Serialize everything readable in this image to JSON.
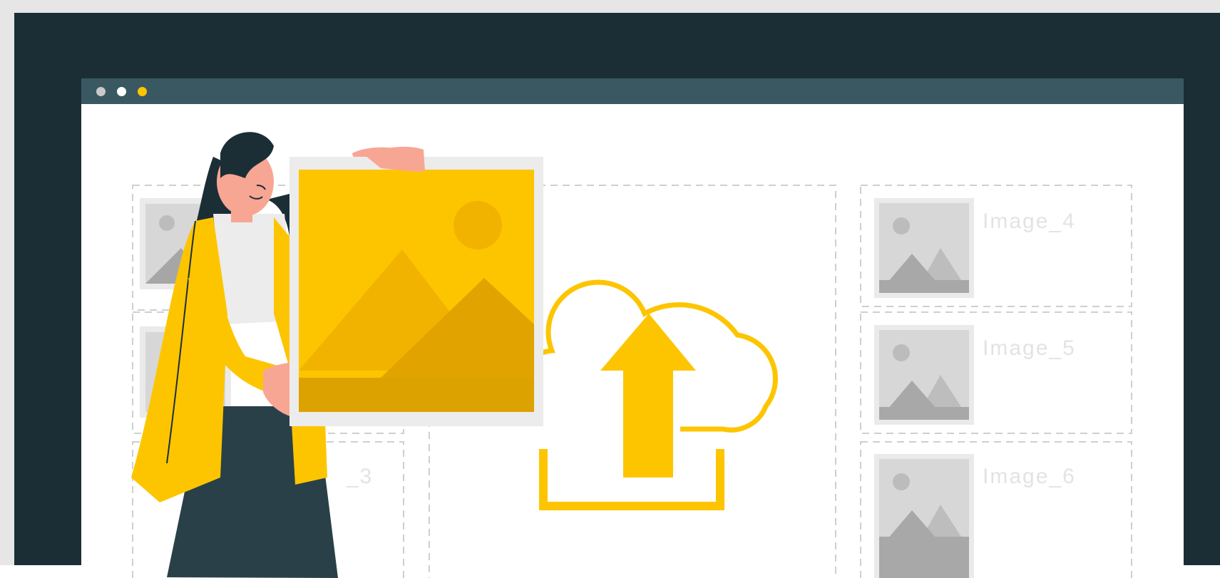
{
  "window": {
    "dots": [
      "grey",
      "white",
      "yellow"
    ]
  },
  "gallery": {
    "tiles": [
      {
        "label": "Image_4"
      },
      {
        "label": "Image_5"
      },
      {
        "label": "Image_6"
      },
      {
        "label": "_3"
      }
    ]
  },
  "illustration": {
    "upload_icon": "cloud-upload-icon",
    "held_image_icon": "image-placeholder-icon",
    "colors": {
      "accent_yellow": "#fdc500",
      "dark_frame": "#1b2e36",
      "titlebar": "#3a5861",
      "placeholder_grey": "#c7c7c7"
    }
  }
}
